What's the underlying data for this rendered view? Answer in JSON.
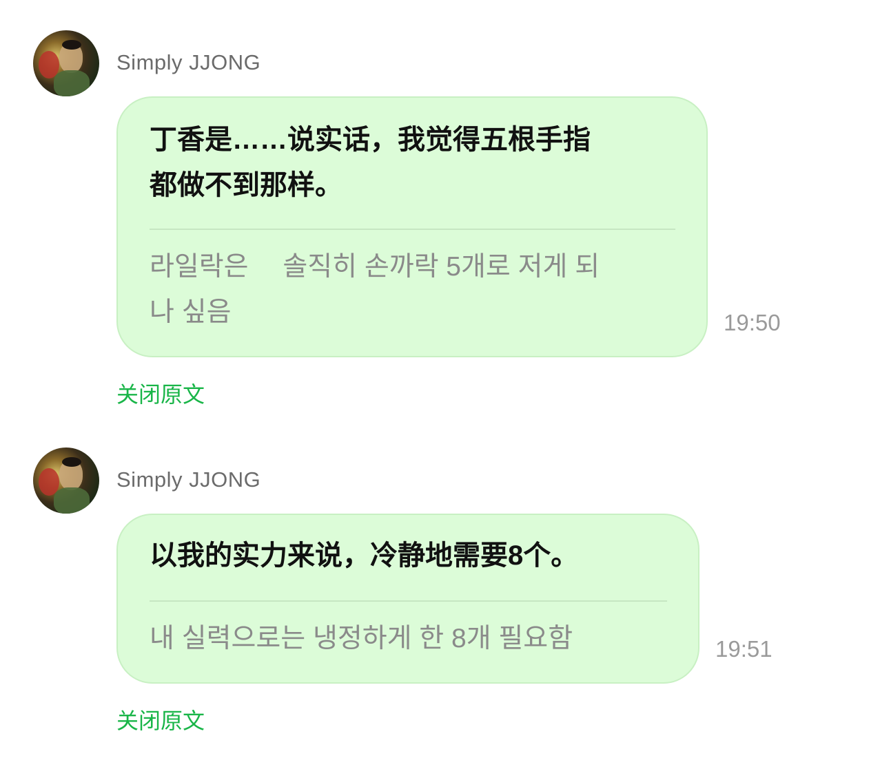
{
  "messages": [
    {
      "sender": "Simply JJONG",
      "original_lines": [
        "丁香是……说实话，我觉得五根手指",
        "都做不到那样。"
      ],
      "translation_lines": [
        "라일락은 　솔직히 손까락 5개로 저게 되",
        "나 싶음"
      ],
      "time": "19:50",
      "close_label": "关闭原文"
    },
    {
      "sender": "Simply JJONG",
      "original_lines": [
        "以我的实力来说，冷静地需要8个。"
      ],
      "translation_lines": [
        "내 실력으로는 냉정하게 한 8개 필요함"
      ],
      "time": "19:51",
      "close_label": "关闭原文"
    }
  ],
  "colors": {
    "bubble_bg": "#dcfcd8",
    "bubble_border": "#c8f0c3",
    "link": "#19b548",
    "translation_text": "#8a8a8a",
    "sender_text": "#6b6b6b"
  },
  "icons": {
    "avatar": "user-avatar-photo"
  }
}
